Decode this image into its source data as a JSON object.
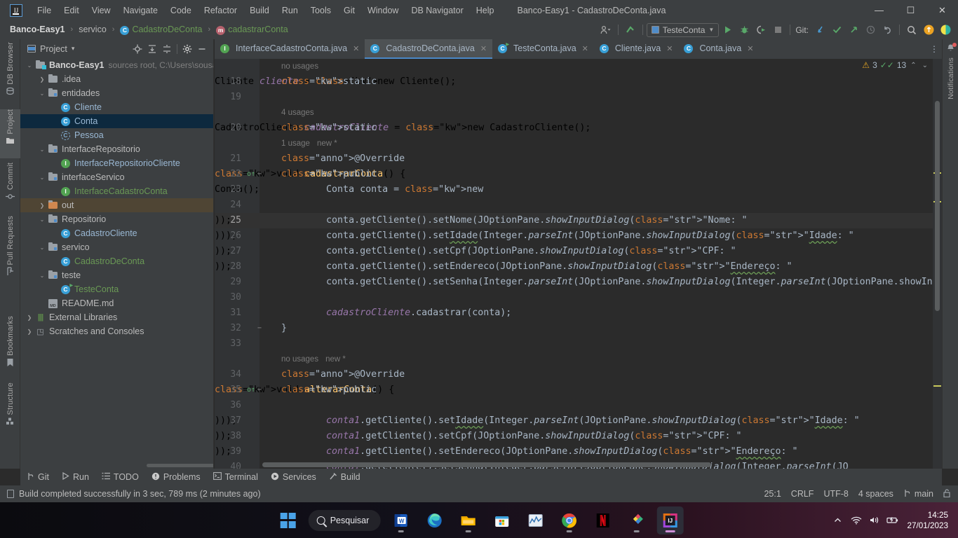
{
  "titlebar": {
    "logo_text": "IJ",
    "menus": [
      "File",
      "Edit",
      "View",
      "Navigate",
      "Code",
      "Refactor",
      "Build",
      "Run",
      "Tools",
      "Git",
      "Window",
      "DB Navigator",
      "Help"
    ],
    "window_title": "Banco-Easy1 - CadastroDeConta.java",
    "minimize": "—",
    "maximize": "☐",
    "close": "✕"
  },
  "navrow": {
    "breadcrumbs": [
      {
        "label": "Banco-Easy1",
        "style": "bold"
      },
      {
        "label": "servico",
        "style": "plain"
      },
      {
        "label": "CadastroDeConta",
        "style": "green",
        "badge": "C"
      },
      {
        "label": "cadastrarConta",
        "style": "green",
        "badge": "m"
      }
    ],
    "separator": "›",
    "run_config": "TesteConta",
    "git_label": "Git:",
    "icons": [
      "user-settings-icon",
      "updates-icon",
      "run-icon",
      "debug-icon",
      "coverage-icon",
      "stop-icon",
      "git-update-icon",
      "git-commit-icon",
      "git-push-icon",
      "git-history-icon",
      "git-rollback-icon",
      "search-everywhere-icon",
      "account-icon",
      "ide-features-icon"
    ]
  },
  "left_rail": [
    {
      "label": "DB Browser",
      "icon": "database-icon",
      "active": false
    },
    {
      "label": "Project",
      "icon": "project-icon",
      "active": true
    },
    {
      "label": "Commit",
      "icon": "commit-icon",
      "active": false
    },
    {
      "label": "Pull Requests",
      "icon": "pull-request-icon",
      "active": false
    },
    {
      "label": "Bookmarks",
      "icon": "bookmark-icon",
      "active": false
    },
    {
      "label": "Structure",
      "icon": "structure-icon",
      "active": false
    }
  ],
  "right_rail": [
    {
      "label": "Notifications",
      "icon": "bell-icon",
      "has_badge": true
    }
  ],
  "project_panel": {
    "title": "Project",
    "dropdown": "▾",
    "actions": [
      "locate-icon",
      "expand-all-icon",
      "collapse-all-icon",
      "settings-icon",
      "hide-icon"
    ],
    "tree": [
      {
        "depth": 0,
        "arrow": "v",
        "icon": "module-root",
        "label": "Banco-Easy1",
        "style": "bold",
        "sub": "sources root,  C:\\Users\\sousa\\",
        "sel": ""
      },
      {
        "depth": 1,
        "arrow": ">",
        "icon": "folder",
        "label": ".idea",
        "style": "plain",
        "sub": "",
        "sel": ""
      },
      {
        "depth": 1,
        "arrow": "v",
        "icon": "folder-src",
        "label": "entidades",
        "style": "plain",
        "sub": "",
        "sel": ""
      },
      {
        "depth": 2,
        "arrow": "",
        "icon": "class",
        "label": "Cliente",
        "style": "blue",
        "sub": "",
        "sel": ""
      },
      {
        "depth": 2,
        "arrow": "",
        "icon": "class",
        "label": "Conta",
        "style": "blue",
        "sub": "",
        "sel": "blue"
      },
      {
        "depth": 2,
        "arrow": "",
        "icon": "class-abstract",
        "label": "Pessoa",
        "style": "blue",
        "sub": "",
        "sel": ""
      },
      {
        "depth": 1,
        "arrow": "v",
        "icon": "folder-src",
        "label": "InterfaceRepositorio",
        "style": "plain",
        "sub": "",
        "sel": ""
      },
      {
        "depth": 2,
        "arrow": "",
        "icon": "interface",
        "label": "InterfaceRepositorioCliente",
        "style": "blue",
        "sub": "",
        "sel": ""
      },
      {
        "depth": 1,
        "arrow": "v",
        "icon": "folder-src",
        "label": "interfaceServico",
        "style": "plain",
        "sub": "",
        "sel": ""
      },
      {
        "depth": 2,
        "arrow": "",
        "icon": "interface",
        "label": "InterfaceCadastroConta",
        "style": "green",
        "sub": "",
        "sel": ""
      },
      {
        "depth": 1,
        "arrow": ">",
        "icon": "folder-excluded",
        "label": "out",
        "style": "plain",
        "sub": "",
        "sel": "orange"
      },
      {
        "depth": 1,
        "arrow": "v",
        "icon": "folder-src",
        "label": "Repositorio",
        "style": "plain",
        "sub": "",
        "sel": ""
      },
      {
        "depth": 2,
        "arrow": "",
        "icon": "class",
        "label": "CadastroCliente",
        "style": "blue",
        "sub": "",
        "sel": ""
      },
      {
        "depth": 1,
        "arrow": "v",
        "icon": "folder-src",
        "label": "servico",
        "style": "plain",
        "sub": "",
        "sel": ""
      },
      {
        "depth": 2,
        "arrow": "",
        "icon": "class",
        "label": "CadastroDeConta",
        "style": "green",
        "sub": "",
        "sel": ""
      },
      {
        "depth": 1,
        "arrow": "v",
        "icon": "folder-src",
        "label": "teste",
        "style": "plain",
        "sub": "",
        "sel": ""
      },
      {
        "depth": 2,
        "arrow": "",
        "icon": "class-runnable",
        "label": "TesteConta",
        "style": "green",
        "sub": "",
        "sel": ""
      },
      {
        "depth": 1,
        "arrow": "",
        "icon": "markdown",
        "label": "README.md",
        "style": "plain",
        "sub": "",
        "sel": ""
      },
      {
        "depth": 0,
        "arrow": ">",
        "icon": "libraries",
        "label": "External Libraries",
        "style": "plain",
        "sub": "",
        "sel": ""
      },
      {
        "depth": 0,
        "arrow": ">",
        "icon": "scratches",
        "label": "Scratches and Consoles",
        "style": "plain",
        "sub": "",
        "sel": ""
      }
    ]
  },
  "editor": {
    "tabs": [
      {
        "label": "InterfaceCadastroConta.java",
        "badge": "I",
        "badge_type": "interface",
        "active": false,
        "close": "✕"
      },
      {
        "label": "CadastroDeConta.java",
        "badge": "C",
        "badge_type": "class",
        "active": true,
        "close": "✕"
      },
      {
        "label": "TesteConta.java",
        "badge": "C",
        "badge_type": "class-runnable",
        "active": false,
        "close": "✕"
      },
      {
        "label": "Cliente.java",
        "badge": "C",
        "badge_type": "class",
        "active": false,
        "close": "✕"
      },
      {
        "label": "Conta.java",
        "badge": "C",
        "badge_type": "class",
        "active": false,
        "close": "✕"
      }
    ],
    "tabs_more": "⋮",
    "inspections": {
      "warning_icon": "warning-triangle-icon",
      "warning_count": "3",
      "check_icon": "double-check-icon",
      "check_count": "13",
      "prev": "⌃",
      "next": "⌄"
    },
    "lines": [
      {
        "num": "",
        "hint": "no usages",
        "gmark": "",
        "fold": "",
        "text": "",
        "caret": false
      },
      {
        "num": "18",
        "hint": "",
        "gmark": "",
        "fold": "",
        "text": "static Cliente cliente = new Cliente();",
        "caret": false
      },
      {
        "num": "19",
        "hint": "",
        "gmark": "",
        "fold": "",
        "text": "",
        "caret": false
      },
      {
        "num": "",
        "hint": "4 usages",
        "gmark": "",
        "fold": "",
        "text": "",
        "caret": false
      },
      {
        "num": "20",
        "hint": "",
        "gmark": "",
        "fold": "",
        "text": "static CadastroCliente cadastroCliente = new CadastroCliente();",
        "caret": false
      },
      {
        "num": "",
        "hint": "1 usage",
        "hint2": "new *",
        "gmark": "",
        "fold": "",
        "text": "",
        "caret": false
      },
      {
        "num": "21",
        "hint": "",
        "gmark": "",
        "fold": "",
        "text": "@Override",
        "caret": false
      },
      {
        "num": "22",
        "hint": "",
        "gmark": "o↑",
        "fold": "−",
        "text": "public void cadastrarConta() {",
        "caret": false
      },
      {
        "num": "23",
        "hint": "",
        "gmark": "",
        "fold": "",
        "text": "Conta conta = new Conta();",
        "caret": false
      },
      {
        "num": "24",
        "hint": "",
        "gmark": "",
        "fold": "",
        "text": "",
        "caret": false
      },
      {
        "num": "25",
        "hint": "",
        "gmark": "",
        "fold": "",
        "text": "conta.getCliente().setNome(JOptionPane.showInputDialog(\"Nome: \"));",
        "caret": true
      },
      {
        "num": "26",
        "hint": "",
        "gmark": "",
        "fold": "",
        "text": "conta.getCliente().setIdade(Integer.parseInt(JOptionPane.showInputDialog(\"Idade: \")));",
        "caret": false
      },
      {
        "num": "27",
        "hint": "",
        "gmark": "",
        "fold": "",
        "text": "conta.getCliente().setCpf(JOptionPane.showInputDialog(\"CPF: \"));",
        "caret": false
      },
      {
        "num": "28",
        "hint": "",
        "gmark": "",
        "fold": "",
        "text": "conta.getCliente().setEndereco(JOptionPane.showInputDialog(\"Endereço: \"));",
        "caret": false
      },
      {
        "num": "29",
        "hint": "",
        "gmark": "",
        "fold": "",
        "text": "conta.getCliente().setSenha(Integer.parseInt(JOptionPane.showInputDialog(Integer.parseInt(JOptionPane.showInputDi",
        "caret": false
      },
      {
        "num": "30",
        "hint": "",
        "gmark": "",
        "fold": "",
        "text": "",
        "caret": false
      },
      {
        "num": "31",
        "hint": "",
        "gmark": "",
        "fold": "",
        "text": "cadastroCliente.cadastrar(conta);",
        "caret": false
      },
      {
        "num": "32",
        "hint": "",
        "gmark": "",
        "fold": "−",
        "text": "}",
        "caret": false
      },
      {
        "num": "33",
        "hint": "",
        "gmark": "",
        "fold": "",
        "text": "",
        "caret": false
      },
      {
        "num": "",
        "hint": "no usages",
        "hint2": "new *",
        "gmark": "",
        "fold": "",
        "text": "",
        "caret": false
      },
      {
        "num": "34",
        "hint": "",
        "gmark": "",
        "fold": "",
        "text": "@Override",
        "caret": false
      },
      {
        "num": "35",
        "hint": "",
        "gmark": "o↑",
        "fold": "−",
        "text": "public void alterarConta() {",
        "caret": false
      },
      {
        "num": "36",
        "hint": "",
        "gmark": "",
        "fold": "",
        "text": "",
        "caret": false
      },
      {
        "num": "37",
        "hint": "",
        "gmark": "",
        "fold": "",
        "text": "conta1.getCliente().setIdade(Integer.parseInt(JOptionPane.showInputDialog(\"Idade: \")));",
        "caret": false
      },
      {
        "num": "38",
        "hint": "",
        "gmark": "",
        "fold": "",
        "text": "conta1.getCliente().setCpf(JOptionPane.showInputDialog(\"CPF: \"));",
        "caret": false
      },
      {
        "num": "39",
        "hint": "",
        "gmark": "",
        "fold": "",
        "text": "conta1.getCliente().setEndereco(JOptionPane.showInputDialog(\"Endereço: \"));",
        "caret": false
      },
      {
        "num": "40",
        "hint": "",
        "gmark": "",
        "fold": "",
        "text": "conta1.getCliente().setSenha(Integer.parseInt(JOptionPane.showInputDialog(Integer.parseInt(JO",
        "caret": false
      }
    ]
  },
  "bottom_tools": [
    {
      "label": "Git",
      "icon": "git-branch-icon"
    },
    {
      "label": "Run",
      "icon": "run-icon"
    },
    {
      "label": "TODO",
      "icon": "todo-list-icon"
    },
    {
      "label": "Problems",
      "icon": "problems-icon"
    },
    {
      "label": "Terminal",
      "icon": "terminal-icon"
    },
    {
      "label": "Services",
      "icon": "services-icon"
    },
    {
      "label": "Build",
      "icon": "build-hammer-icon"
    }
  ],
  "statusbar": {
    "message": "Build completed successfully in 3 sec, 789 ms (2 minutes ago)",
    "caret_position": "25:1",
    "line_separator": "CRLF",
    "encoding": "UTF-8",
    "indent": "4 spaces",
    "branch": "main",
    "branch_icon": "git-branch-icon",
    "lock_icon": "unlocked-icon"
  },
  "taskbar": {
    "search_placeholder": "Pesquisar",
    "start_icon": "windows-start-icon",
    "apps": [
      {
        "name": "word-icon",
        "label": "W",
        "running": true,
        "active": false
      },
      {
        "name": "edge-icon",
        "label": "",
        "running": false,
        "active": false
      },
      {
        "name": "file-explorer-icon",
        "label": "",
        "running": true,
        "active": false
      },
      {
        "name": "microsoft-store-icon",
        "label": "",
        "running": false,
        "active": false
      },
      {
        "name": "task-manager-icon",
        "label": "",
        "running": false,
        "active": false
      },
      {
        "name": "chrome-icon",
        "label": "",
        "running": true,
        "active": false
      },
      {
        "name": "netflix-icon",
        "label": "N",
        "running": false,
        "active": false
      },
      {
        "name": "paint-icon",
        "label": "",
        "running": true,
        "active": false
      },
      {
        "name": "intellij-idea-icon",
        "label": "IJ",
        "running": true,
        "active": true
      }
    ],
    "tray": [
      {
        "name": "show-hidden-icons-icon",
        "glyph": "⌃"
      },
      {
        "name": "wifi-icon",
        "glyph": "◥"
      },
      {
        "name": "volume-icon",
        "glyph": "🕪"
      },
      {
        "name": "battery-icon",
        "glyph": "▭"
      }
    ],
    "time": "14:25",
    "date": "27/01/2023"
  },
  "colors": {
    "panel_bg": "#3c3f41",
    "editor_bg": "#2b2b2b",
    "gutter_bg": "#313335",
    "accent_blue": "#4a88c7",
    "keyword_orange": "#cc7832",
    "string_green": "#6a8759",
    "field_purple": "#9876aa",
    "annotation_yellow": "#bbb529",
    "method_yellow": "#ffc66d",
    "text_default": "#a9b7c6",
    "selection_blue": "#0d293e",
    "excluded_orange": "#4f4534"
  }
}
